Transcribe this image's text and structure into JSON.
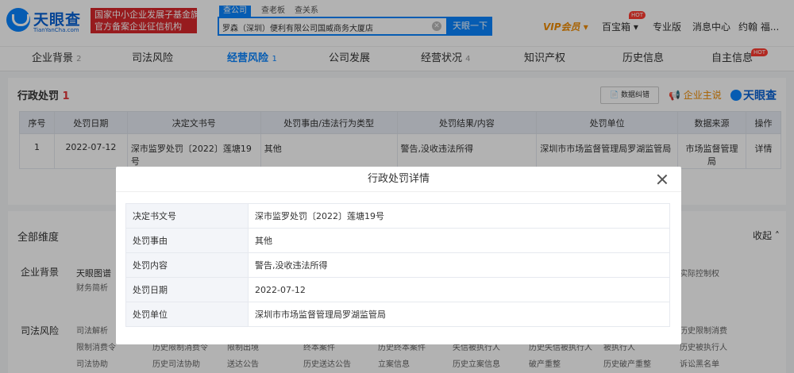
{
  "brand": {
    "name": "天眼查",
    "domain": "TianYanCha.com",
    "badge_line1": "国家中小企业发展子基金旗下",
    "badge_line2": "官方备案企业征信机构"
  },
  "search": {
    "tabs": [
      "查公司",
      "查老板",
      "查关系"
    ],
    "query": "罗森（深圳）便利有限公司国威商务大厦店",
    "button": "天眼一下"
  },
  "nav": {
    "vip": "VIP会员",
    "baibaoxiang": "百宝箱",
    "hot": "HOT",
    "pro": "专业版",
    "messages": "消息中心",
    "user": "约翰 福..."
  },
  "tabs": [
    {
      "label": "企业背景",
      "count": "2"
    },
    {
      "label": "司法风险",
      "count": ""
    },
    {
      "label": "经营风险",
      "count": "1"
    },
    {
      "label": "公司发展",
      "count": ""
    },
    {
      "label": "经营状况",
      "count": "4"
    },
    {
      "label": "知识产权",
      "count": ""
    },
    {
      "label": "历史信息",
      "count": ""
    },
    {
      "label": "自主信息",
      "count": ""
    }
  ],
  "section": {
    "title": "行政处罚",
    "count": "1",
    "error_btn": "数据纠错",
    "claim_btn": "企业主说",
    "brand": "天眼查",
    "columns": [
      "序号",
      "处罚日期",
      "决定文书号",
      "处罚事由/违法行为类型",
      "处罚结果/内容",
      "处罚单位",
      "数据来源",
      "操作"
    ],
    "rows": [
      [
        "1",
        "2022-07-12",
        "深市监罗处罚〔2022〕莲塘19号",
        "其他",
        "警告,没收违法所得",
        "深圳市市场监督管理局罗湖监管局",
        "市场监督管理局",
        "详情"
      ]
    ]
  },
  "dims": {
    "title": "全部维度",
    "collapse": "收起",
    "rows": [
      {
        "label": "企业背景",
        "items": [
          "天眼图谱",
          "",
          "",
          "",
          "",
          "",
          "",
          "",
          "",
          "实际控制权"
        ],
        "items2": [
          "财务简析"
        ]
      },
      {
        "label": "司法风险",
        "items": [
          "司法解析",
          "",
          "",
          "",
          "",
          "",
          "",
          "",
          "",
          "历史限制消费"
        ],
        "items2": [
          "限制消费令",
          "历史限制消费令",
          "限制出境",
          "终本案件",
          "历史终本案件",
          "失信被执行人",
          "历史失信被执行人",
          "被执行人",
          "历史被执行人"
        ],
        "items3": [
          "司法协助",
          "历史司法协助",
          "送达公告",
          "历史送达公告",
          "立案信息",
          "历史立案信息",
          "破产重整",
          "历史破产重整",
          "诉讼黑名单"
        ]
      }
    ]
  },
  "modal": {
    "title": "行政处罚详情",
    "fields": [
      {
        "k": "决定书文号",
        "v": "深市监罗处罚〔2022〕莲塘19号"
      },
      {
        "k": "处罚事由",
        "v": "其他"
      },
      {
        "k": "处罚内容",
        "v": "警告,没收违法所得"
      },
      {
        "k": "处罚日期",
        "v": "2022-07-12"
      },
      {
        "k": "处罚单位",
        "v": "深圳市市场监督管理局罗湖监管局"
      }
    ]
  },
  "colors": {
    "primary": "#0a85ff",
    "red": "#e4393c",
    "orange": "#f08c00"
  }
}
